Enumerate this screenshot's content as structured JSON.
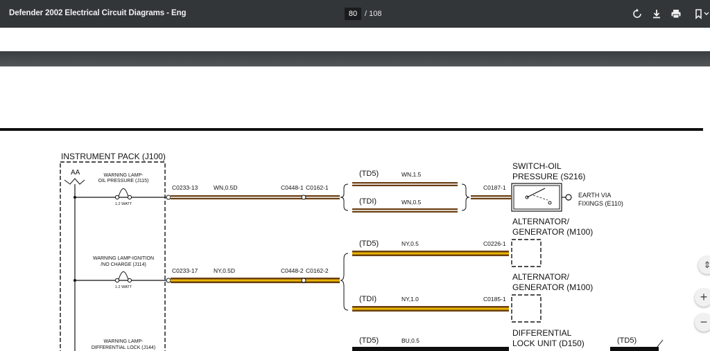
{
  "toolbar": {
    "title": "Defender 2002 Electrical Circuit Diagrams - Eng",
    "current_page": "80",
    "total_pages": "/ 108",
    "icons": [
      "rotate-icon",
      "download-icon",
      "print-icon",
      "bookmark-icon"
    ]
  },
  "diagram": {
    "instrument_pack_title": "INSTRUMENT PACK (J100)",
    "aa_label": "AA",
    "lamp1_title_line1": "WARNING LAMP-",
    "lamp1_title_line2": "OIL PRESSURE (J115)",
    "lamp1_watt": "1.2 WATT",
    "lamp2_title_line1": "WARNING LAMP-IGNITION",
    "lamp2_title_line2": "/NO CHARGE (J114)",
    "lamp2_watt": "1.2 WATT",
    "lamp3_title_line1": "WARNING LAMP-",
    "lamp3_title_line2": "DIFFERENTIAL LOCK (J144)",
    "conn_c0233_13": "C0233-13",
    "wire_wn05d": "WN,0.5D",
    "conn_c0448_1": "C0448-1",
    "conn_c0162_1": "C0162-1",
    "conn_c0233_17": "C0233-17",
    "wire_ny05d": "NY,0.5D",
    "conn_c0448_2": "C0448-2",
    "conn_c0162_2": "C0162-2",
    "td5_a": "(TD5)",
    "wire_wn15": "WN,1.5",
    "tdi_a": "(TDI)",
    "wire_wn05": "WN,0.5",
    "conn_c0187_1": "C0187-1",
    "switch_title_line1": "SWITCH-OIL",
    "switch_title_line2": "PRESSURE (S216)",
    "earth_line1": "EARTH VIA",
    "earth_line2": "FIXINGS (E110)",
    "alt1_line1": "ALTERNATOR/",
    "alt1_line2": "GENERATOR (M100)",
    "td5_b": "(TD5)",
    "wire_ny05": "NY,0.5",
    "conn_c0226_1": "C0226-1",
    "alt2_line1": "ALTERNATOR/",
    "alt2_line2": "GENERATOR (M100)",
    "tdi_b": "(TDI)",
    "wire_ny10": "NY,1.0",
    "conn_c0185_1": "C0185-1",
    "td5_c": "(TD5)",
    "wire_bu05": "BU,0.5",
    "diff_line1": "DIFFERENTIAL",
    "diff_line2": "LOCK UNIT (D150)",
    "td5_d": "(TD5)"
  },
  "zoom": {
    "fit_symbol": "⇕",
    "zoom_in_symbol": "+",
    "zoom_out_symbol": "−"
  },
  "colors": {
    "toolbar_bg": "#323639",
    "wire_brown": "#6b3e12",
    "wire_yellow": "#e7b600",
    "wire_white": "#d9d2c6"
  }
}
